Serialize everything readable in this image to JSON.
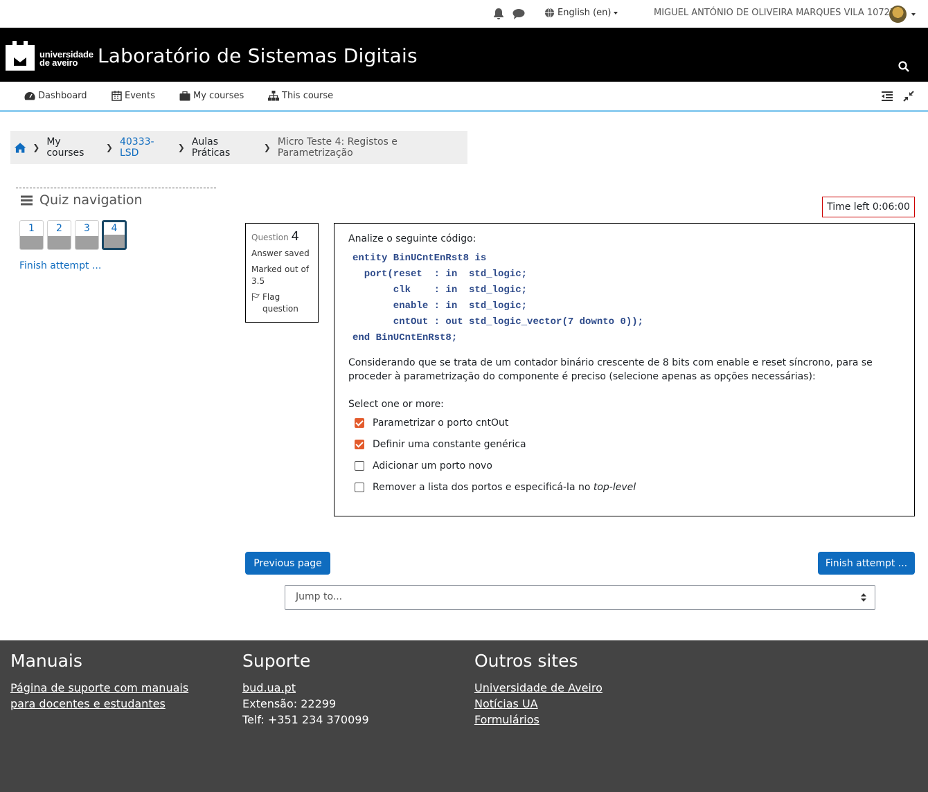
{
  "topbar": {
    "language": "English (en)",
    "user_name": "MIGUEL ANTÓNIO DE OLIVEIRA MARQUES VILA 107276"
  },
  "header": {
    "logo_line1": "universidade",
    "logo_line2": "de aveiro",
    "site_title": "Laboratório de Sistemas Digitais"
  },
  "nav": {
    "dashboard": "Dashboard",
    "events": "Events",
    "my_courses": "My courses",
    "this_course": "This course"
  },
  "breadcrumb": {
    "my_courses": "My courses",
    "course": "40333-LSD",
    "section": "Aulas Práticas",
    "current": "Micro Teste 4: Registos e Parametrização"
  },
  "quiz_nav": {
    "title": "Quiz navigation",
    "questions": [
      "1",
      "2",
      "3",
      "4"
    ],
    "finish_link": "Finish attempt ..."
  },
  "timer": "Time left 0:06:00",
  "question_info": {
    "label": "Question",
    "number": "4",
    "state": "Answer saved",
    "marked": "Marked out of 3.5",
    "flag": "Flag question"
  },
  "question": {
    "intro": "Analize o seguinte código:",
    "code": "entity BinUCntEnRst8 is\n  port(reset  : in  std_logic;\n       clk    : in  std_logic;\n       enable : in  std_logic;\n       cntOut : out std_logic_vector(7 downto 0));\nend BinUCntEnRst8;",
    "description": "Considerando que se trata de um contador binário crescente de 8 bits com enable e reset síncrono, para se proceder à parametrização do componente é preciso (selecione apenas as opções necessárias):",
    "prompt": "Select one or more:",
    "options": [
      {
        "label": "Parametrizar o porto cntOut",
        "checked": true
      },
      {
        "label": "Definir uma constante genérica",
        "checked": true
      },
      {
        "label": "Adicionar um porto novo",
        "checked": false
      },
      {
        "label": "Remover a lista dos portos e especificá-la no ",
        "emph": "top-level",
        "checked": false
      }
    ]
  },
  "buttons": {
    "previous": "Previous page",
    "finish": "Finish attempt ..."
  },
  "jump": {
    "placeholder": "Jump to..."
  },
  "footer": {
    "manuais": {
      "title": "Manuais",
      "link_line1": "Página de suporte com manuais",
      "link_line2": "para docentes e estudantes"
    },
    "suporte": {
      "title": "Suporte",
      "link": "bud.ua.pt",
      "extension": "Extensão: 22299",
      "phone": "Telf: +351 234 370099"
    },
    "outros": {
      "title": "Outros sites",
      "links": [
        "Universidade de Aveiro",
        "Notícias UA",
        "Formulários"
      ]
    }
  },
  "colors": {
    "link": "#0f6cbf",
    "checkbox": "#e35b2c",
    "footer_bg": "#444444",
    "header_bg": "#000000",
    "nav_accent": "#8fcdf0"
  }
}
